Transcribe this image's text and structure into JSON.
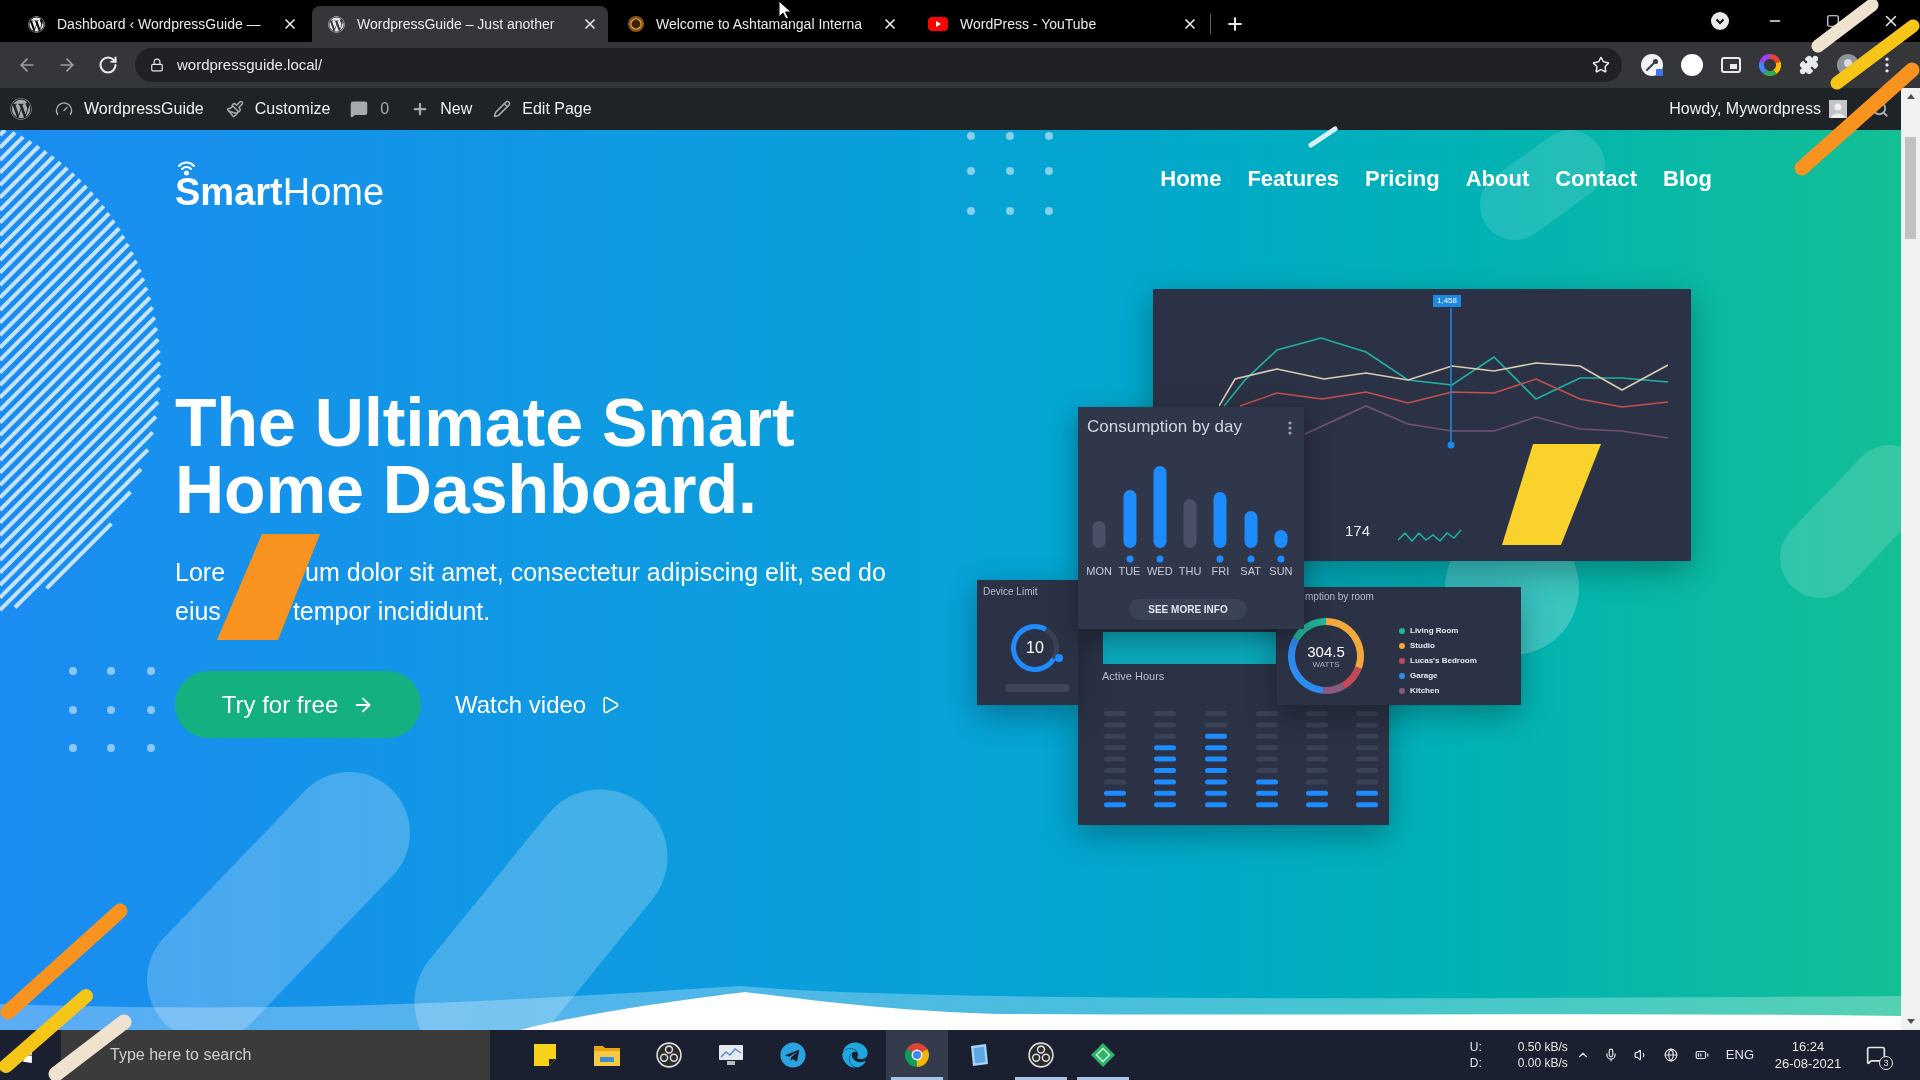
{
  "browser": {
    "tabs": [
      {
        "title": "Dashboard ‹ WordpressGuide —",
        "kind": "wordpress",
        "selected": false
      },
      {
        "title": "WordpressGuide – Just another",
        "kind": "wordpress",
        "selected": true
      },
      {
        "title": "Welcome to Ashtamangal Interna",
        "kind": "site",
        "selected": false
      },
      {
        "title": "WordPress - YouTube",
        "kind": "youtube",
        "selected": false
      }
    ],
    "address": {
      "value": "wordpressguide.local/"
    }
  },
  "admin_bar": {
    "site_name": "WordpressGuide",
    "customize": "Customize",
    "comments": "0",
    "new": "New",
    "edit": "Edit Page",
    "greeting": "Howdy, Mywordpress"
  },
  "hero": {
    "logo": "**Smart**Home",
    "nav": [
      "Home",
      "Features",
      "Pricing",
      "About",
      "Contact",
      "Blog"
    ],
    "headline": "The Ultimate Smart Home Dashboard.",
    "paragraph_lines": [
      [
        "Lore",
        "um dolor sit amet, consectetur adipiscing elit, sed do"
      ],
      [
        "eius",
        "tempor incididunt."
      ]
    ],
    "primary_button": "Try for free",
    "secondary_button": "Watch video"
  },
  "dashboard_mockup": {
    "line_card": {
      "tooltip": "1,458",
      "total": "174"
    },
    "day_card": {
      "title": "Consumption by day",
      "days": [
        {
          "label": "MON",
          "active": false
        },
        {
          "label": "TUE",
          "active": true
        },
        {
          "label": "WED",
          "active": true
        },
        {
          "label": "THU",
          "active": false
        },
        {
          "label": "FRI",
          "active": true
        },
        {
          "label": "SAT",
          "active": true
        },
        {
          "label": "SUN",
          "active": true
        }
      ],
      "button": "SEE MORE INFO"
    },
    "device_card": {
      "title": "Device Limit",
      "value": "10"
    },
    "hours_card": {
      "title": "Active Hours"
    },
    "room_card": {
      "title": "mption by room",
      "value": "304.5",
      "unit": "WATTS",
      "rooms": [
        {
          "name": "Living Room",
          "color": "#23b59a"
        },
        {
          "name": "Studio",
          "color": "#f2a93b"
        },
        {
          "name": "Lucas's Bedroom",
          "color": "#c24a58"
        },
        {
          "name": "Garage",
          "color": "#2d8cf0"
        },
        {
          "name": "Kitchen",
          "color": "#8a5a7e"
        }
      ]
    }
  },
  "taskbar": {
    "search": {
      "placeholder": "Type here to search"
    },
    "apps": [
      {
        "kind": "notes",
        "open": false,
        "selected": false
      },
      {
        "kind": "folder",
        "open": false,
        "selected": false
      },
      {
        "kind": "obs",
        "open": false,
        "selected": false
      },
      {
        "kind": "monitor",
        "open": false,
        "selected": false
      },
      {
        "kind": "telegram",
        "open": false,
        "selected": false
      },
      {
        "kind": "edge",
        "open": false,
        "selected": false
      },
      {
        "kind": "chrome",
        "open": true,
        "selected": true
      },
      {
        "kind": "tablet",
        "open": false,
        "selected": false
      },
      {
        "kind": "obs",
        "open": true,
        "selected": false
      },
      {
        "kind": "diamond",
        "open": true,
        "selected": false
      }
    ],
    "network": {
      "up_label": "U:",
      "down_label": "D:",
      "up": "0.50 kB/s",
      "down": "0.00 kB/s"
    },
    "language": "ENG",
    "time": "16:24",
    "date": "26-08-2021",
    "notifications": "3"
  }
}
